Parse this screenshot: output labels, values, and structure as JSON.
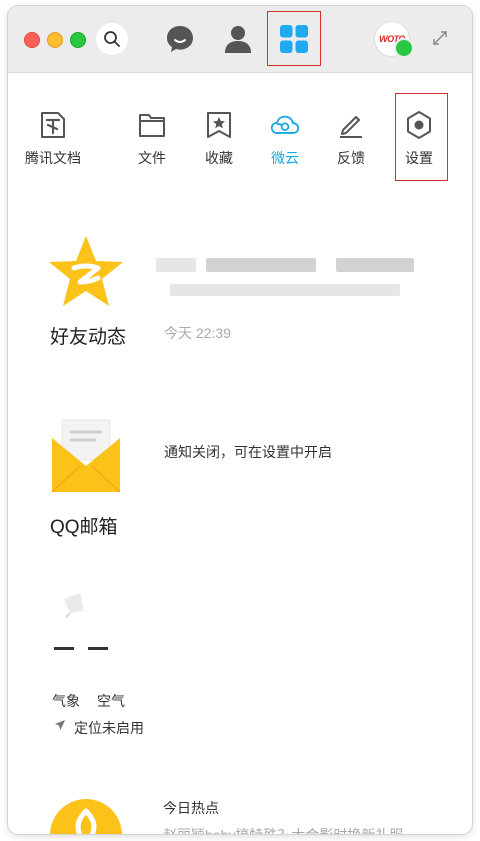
{
  "toolbar": {
    "items": [
      {
        "label": "腾讯文档",
        "icon": "tencent-docs-icon"
      },
      {
        "label": "文件",
        "icon": "folder-icon"
      },
      {
        "label": "收藏",
        "icon": "favorites-icon"
      },
      {
        "label": "微云",
        "icon": "cloud-icon"
      },
      {
        "label": "反馈",
        "icon": "pen-icon"
      },
      {
        "label": "设置",
        "icon": "settings-hex-icon"
      }
    ]
  },
  "avatar": {
    "text": "WOTO"
  },
  "cards": {
    "qzone": {
      "title": "好友动态",
      "time": "今天 22:39"
    },
    "mail": {
      "title": "QQ邮箱",
      "notice": "通知关闭，可在设置中开启"
    },
    "weather": {
      "temp_placeholder": "– –",
      "labels": [
        "气象",
        "空气"
      ],
      "location": "定位未启用"
    },
    "news": {
      "title": "今日热点",
      "headline": "赵丽颖baby搞特殊？大合影时换新礼服"
    }
  },
  "colors": {
    "accent": "#15a7e0",
    "highlight_border": "#d9302d",
    "app_tile": "#1fa9f0",
    "qzone_yellow": "#fbc21a"
  }
}
